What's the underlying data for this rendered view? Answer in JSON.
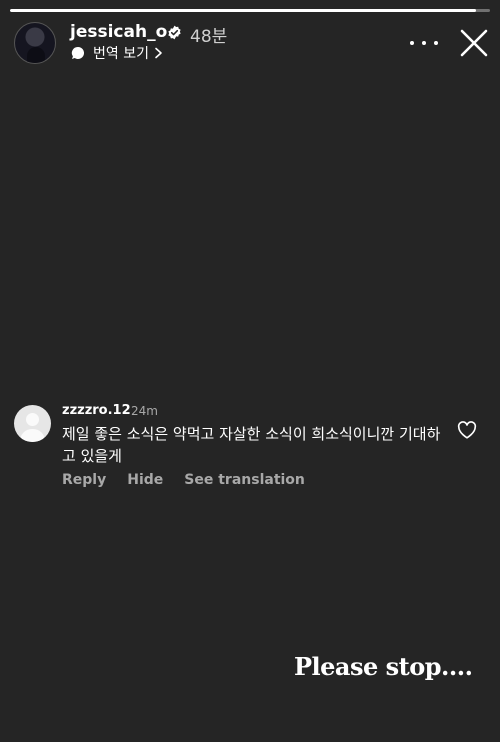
{
  "story": {
    "progress": 0.97,
    "username": "jessicah_o",
    "verified": true,
    "time_ago": "48분",
    "translate_label": "번역 보기",
    "caption": "Please stop...."
  },
  "comment": {
    "username": "zzzzro.12",
    "time_ago": "24m",
    "text": "제일 좋은 소식은 약먹고 자살한 소식이 희소식이니깐 기대하고 있을게",
    "actions": {
      "reply": "Reply",
      "hide": "Hide",
      "see_translation": "See translation"
    }
  },
  "icons": {
    "verified": "verified-badge-icon",
    "translate": "speech-bubble-icon",
    "chevron": "chevron-right-icon",
    "more": "more-horizontal-icon",
    "close": "close-icon",
    "like": "heart-icon"
  },
  "colors": {
    "background": "#252525",
    "secondary_text": "#a8a8a8"
  }
}
